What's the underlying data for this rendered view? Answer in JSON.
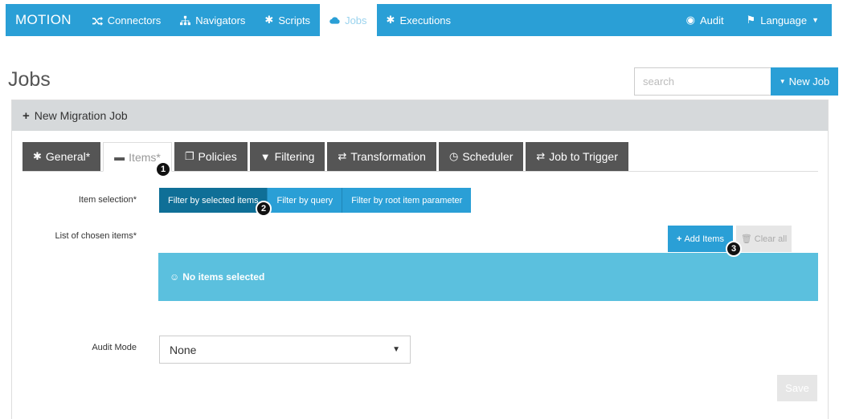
{
  "navbar": {
    "brand": "MOTION",
    "items": [
      {
        "label": "Connectors",
        "icon": "shuffle-icon"
      },
      {
        "label": "Navigators",
        "icon": "sitemap-icon"
      },
      {
        "label": "Scripts",
        "icon": "gear-icon"
      },
      {
        "label": "Jobs",
        "icon": "cloud-icon"
      },
      {
        "label": "Executions",
        "icon": "gear-icon"
      }
    ],
    "right": [
      {
        "label": "Audit",
        "icon": "eye-icon"
      },
      {
        "label": "Language",
        "icon": "flag-icon"
      }
    ]
  },
  "header": {
    "title": "Jobs",
    "search_placeholder": "search",
    "new_job_label": "New Job"
  },
  "panel": {
    "heading": "New Migration Job",
    "tabs": [
      {
        "label": "General*",
        "icon": "gear-icon"
      },
      {
        "label": "Items*",
        "icon": "archive-icon"
      },
      {
        "label": "Policies",
        "icon": "copy-icon"
      },
      {
        "label": "Filtering",
        "icon": "filter-icon"
      },
      {
        "label": "Transformation",
        "icon": "exchange-icon"
      },
      {
        "label": "Scheduler",
        "icon": "clock-icon"
      },
      {
        "label": "Job to Trigger",
        "icon": "exchange-icon"
      }
    ],
    "item_selection_label": "Item selection*",
    "selection_options": [
      "Filter by selected items",
      "Filter by query",
      "Filter by root item parameter"
    ],
    "chosen_items_label": "List of chosen items*",
    "add_items_label": "Add Items",
    "clear_all_label": "Clear all",
    "empty_message": "No items selected",
    "audit_mode_label": "Audit Mode",
    "audit_mode_value": "None",
    "save_label": "Save"
  },
  "badges": [
    "1",
    "2",
    "3"
  ],
  "colors": {
    "primary": "#2a9fd6",
    "primary_dark": "#0f6f97",
    "info": "#5bc0de",
    "tab_dark": "#555555"
  }
}
